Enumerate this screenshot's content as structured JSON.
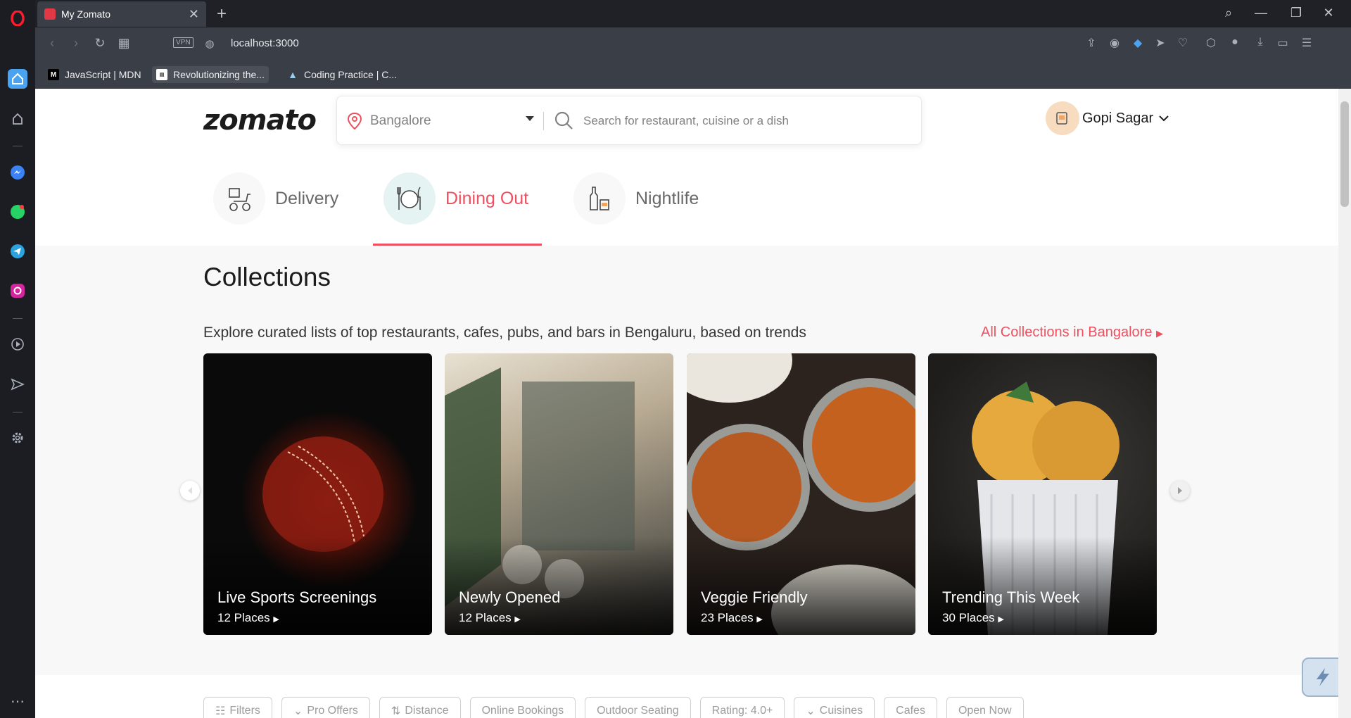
{
  "browser": {
    "tab_title": "My Zomato",
    "url": "localhost:3000",
    "vpn_label": "VPN",
    "bookmarks": [
      {
        "label": "JavaScript | MDN"
      },
      {
        "label": "Revolutionizing the..."
      },
      {
        "label": "Coding Practice | C..."
      }
    ]
  },
  "header": {
    "logo": "zomato",
    "location": "Bangalore",
    "search_placeholder": "Search for restaurant, cuisine or a dish",
    "user_name": "Gopi Sagar"
  },
  "categories": [
    {
      "label": "Delivery",
      "icon": "delivery-scooter-icon"
    },
    {
      "label": "Dining Out",
      "icon": "dining-out-icon",
      "active": true
    },
    {
      "label": "Nightlife",
      "icon": "nightlife-icon"
    }
  ],
  "collections": {
    "title": "Collections",
    "subtitle": "Explore curated lists of top restaurants, cafes, pubs, and bars in Bengaluru, based on trends",
    "all_link": "All Collections in Bangalore",
    "cards": [
      {
        "title": "Live Sports Screenings",
        "places": "12 Places"
      },
      {
        "title": "Newly Opened",
        "places": "12 Places"
      },
      {
        "title": "Veggie Friendly",
        "places": "23 Places"
      },
      {
        "title": "Trending This Week",
        "places": "30 Places"
      }
    ]
  },
  "filters": [
    {
      "label": "Filters"
    },
    {
      "label": "Pro Offers"
    },
    {
      "label": "Distance"
    },
    {
      "label": "Online Bookings"
    },
    {
      "label": "Outdoor Seating"
    },
    {
      "label": "Rating: 4.0+"
    },
    {
      "label": "Cuisines"
    },
    {
      "label": "Cafes"
    },
    {
      "label": "Open Now"
    }
  ],
  "colors": {
    "brand": "#ef4f5f",
    "browser_dark": "#1b1d22"
  }
}
